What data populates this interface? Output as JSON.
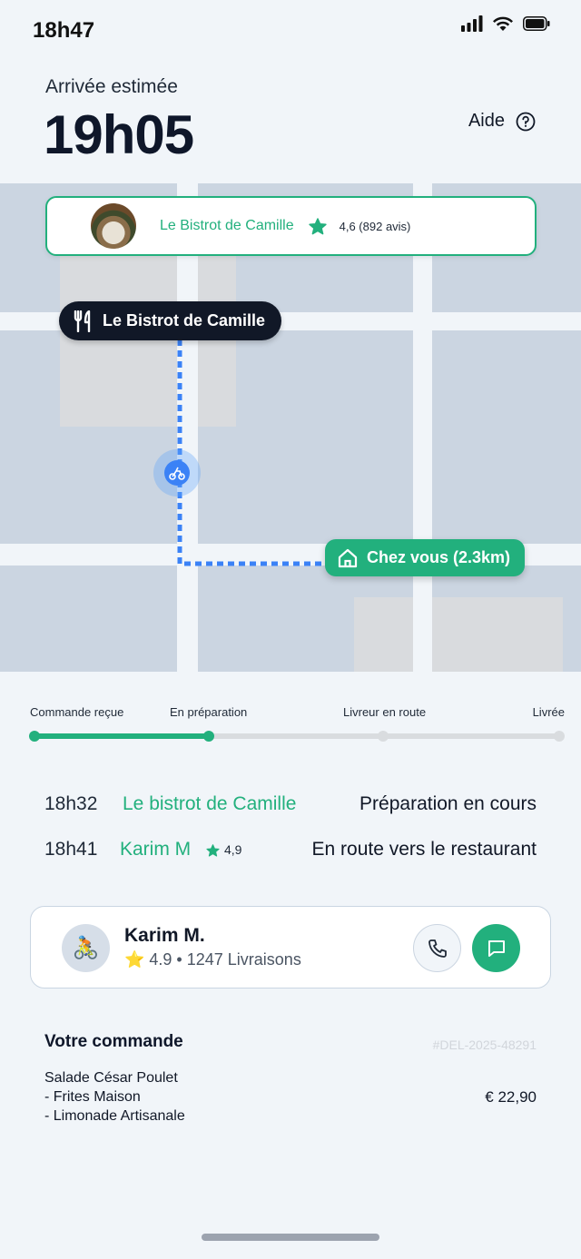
{
  "status_bar": {
    "time": "18h47"
  },
  "eta": {
    "label": "Arrivée estimée",
    "time": "19h05"
  },
  "help": {
    "label": "Aide"
  },
  "restaurant_card": {
    "name": "Le Bistrot de Camille",
    "rating": "4,6 (892 avis)"
  },
  "map": {
    "restaurant_pin": "Le Bistrot de Camille",
    "home_pin": "Chez vous (2.3km)"
  },
  "progress": {
    "steps": [
      "Commande reçue",
      "En préparation",
      "Livreur en route",
      "Livrée"
    ],
    "current_step": 2,
    "completed_fraction": 0.333
  },
  "timeline": [
    {
      "time": "18h32",
      "who": "Le bistrot de Camille",
      "status": "Préparation en cours"
    },
    {
      "time": "18h41",
      "who": "Karim M",
      "rating": "4,9",
      "status": "En route vers le restaurant"
    }
  ],
  "driver": {
    "name": "Karim M.",
    "meta": "⭐ 4.9 • 1247 Livraisons",
    "avatar_emoji": "🚴"
  },
  "order": {
    "title": "Votre commande",
    "id": "#DEL-2025-48291",
    "items": [
      "Salade César Poulet",
      "- Frites Maison",
      "- Limonade Artisanale"
    ],
    "total": "€ 22,90"
  },
  "colors": {
    "accent": "#22b07d",
    "route": "#3b82f6",
    "dark": "#111827"
  }
}
